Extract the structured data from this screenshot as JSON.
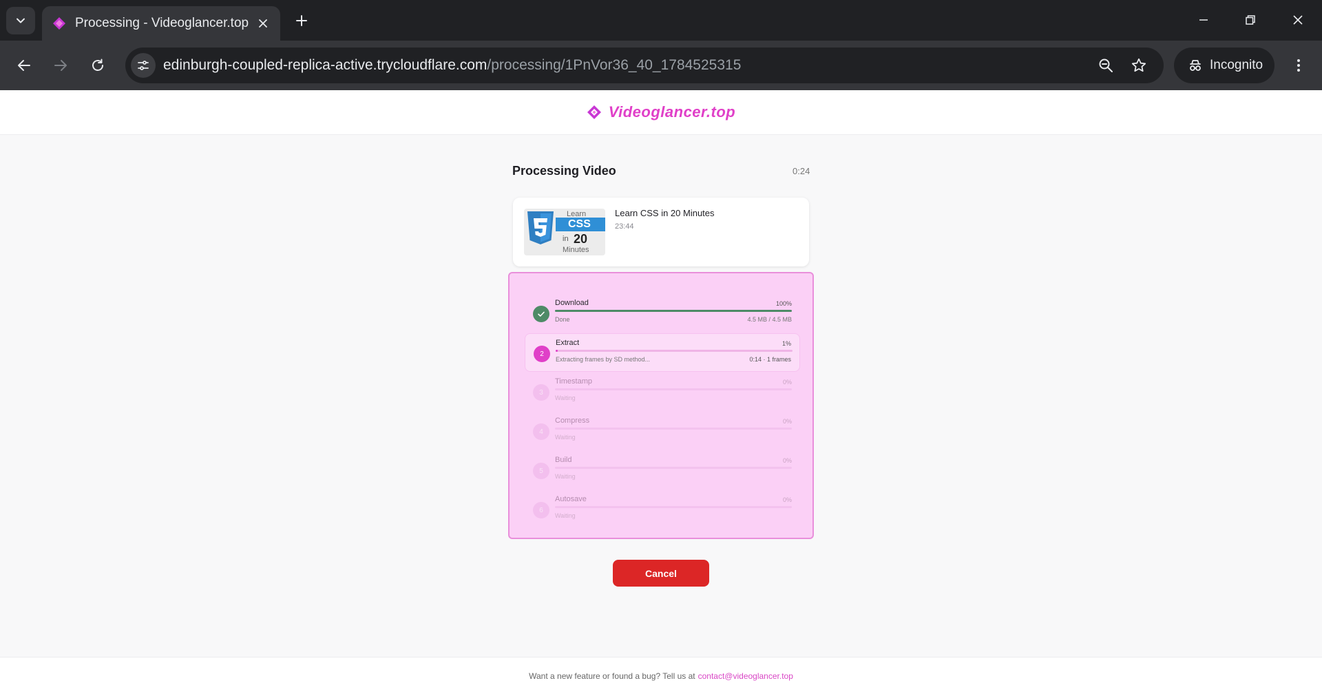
{
  "browser": {
    "tab_title": "Processing - Videoglancer.top",
    "url_host": "edinburgh-coupled-replica-active.trycloudflare.com",
    "url_path": "/processing/1PnVor36_40_1784525315",
    "incognito_label": "Incognito"
  },
  "site": {
    "brand": "Videoglancer.top",
    "brand_color": "#e040c8"
  },
  "page": {
    "heading": "Processing Video",
    "timer": "0:24"
  },
  "video": {
    "title": "Learn CSS in 20 Minutes",
    "duration": "23:44",
    "thumb": {
      "learn": "Learn",
      "css": "CSS",
      "in": "in",
      "num": "20",
      "minutes": "Minutes"
    }
  },
  "steps": [
    {
      "name": "Download",
      "percent": "100%",
      "progress": 1.0,
      "status": "Done",
      "meta": "4.5 MB / 4.5 MB",
      "state": "done",
      "marker": ""
    },
    {
      "name": "Extract",
      "percent": "1%",
      "progress": 0.01,
      "status": "Extracting frames by SD method...",
      "meta": "0:14 · 1 frames",
      "state": "active",
      "marker": "2"
    },
    {
      "name": "Timestamp",
      "percent": "0%",
      "progress": 0,
      "status": "Waiting",
      "meta": "",
      "state": "waiting",
      "marker": "3"
    },
    {
      "name": "Compress",
      "percent": "0%",
      "progress": 0,
      "status": "Waiting",
      "meta": "",
      "state": "waiting",
      "marker": "4"
    },
    {
      "name": "Build",
      "percent": "0%",
      "progress": 0,
      "status": "Waiting",
      "meta": "",
      "state": "waiting",
      "marker": "5"
    },
    {
      "name": "Autosave",
      "percent": "0%",
      "progress": 0,
      "status": "Waiting",
      "meta": "",
      "state": "waiting",
      "marker": "6"
    }
  ],
  "actions": {
    "cancel_label": "Cancel"
  },
  "footer": {
    "text": "Want a new feature or found a bug? Tell us at",
    "email": "contact@videoglancer.top"
  },
  "colors": {
    "done": "#4e8a67",
    "active": "#e040c8",
    "cancel": "#dc2626",
    "panel": "#fbd0f6"
  }
}
